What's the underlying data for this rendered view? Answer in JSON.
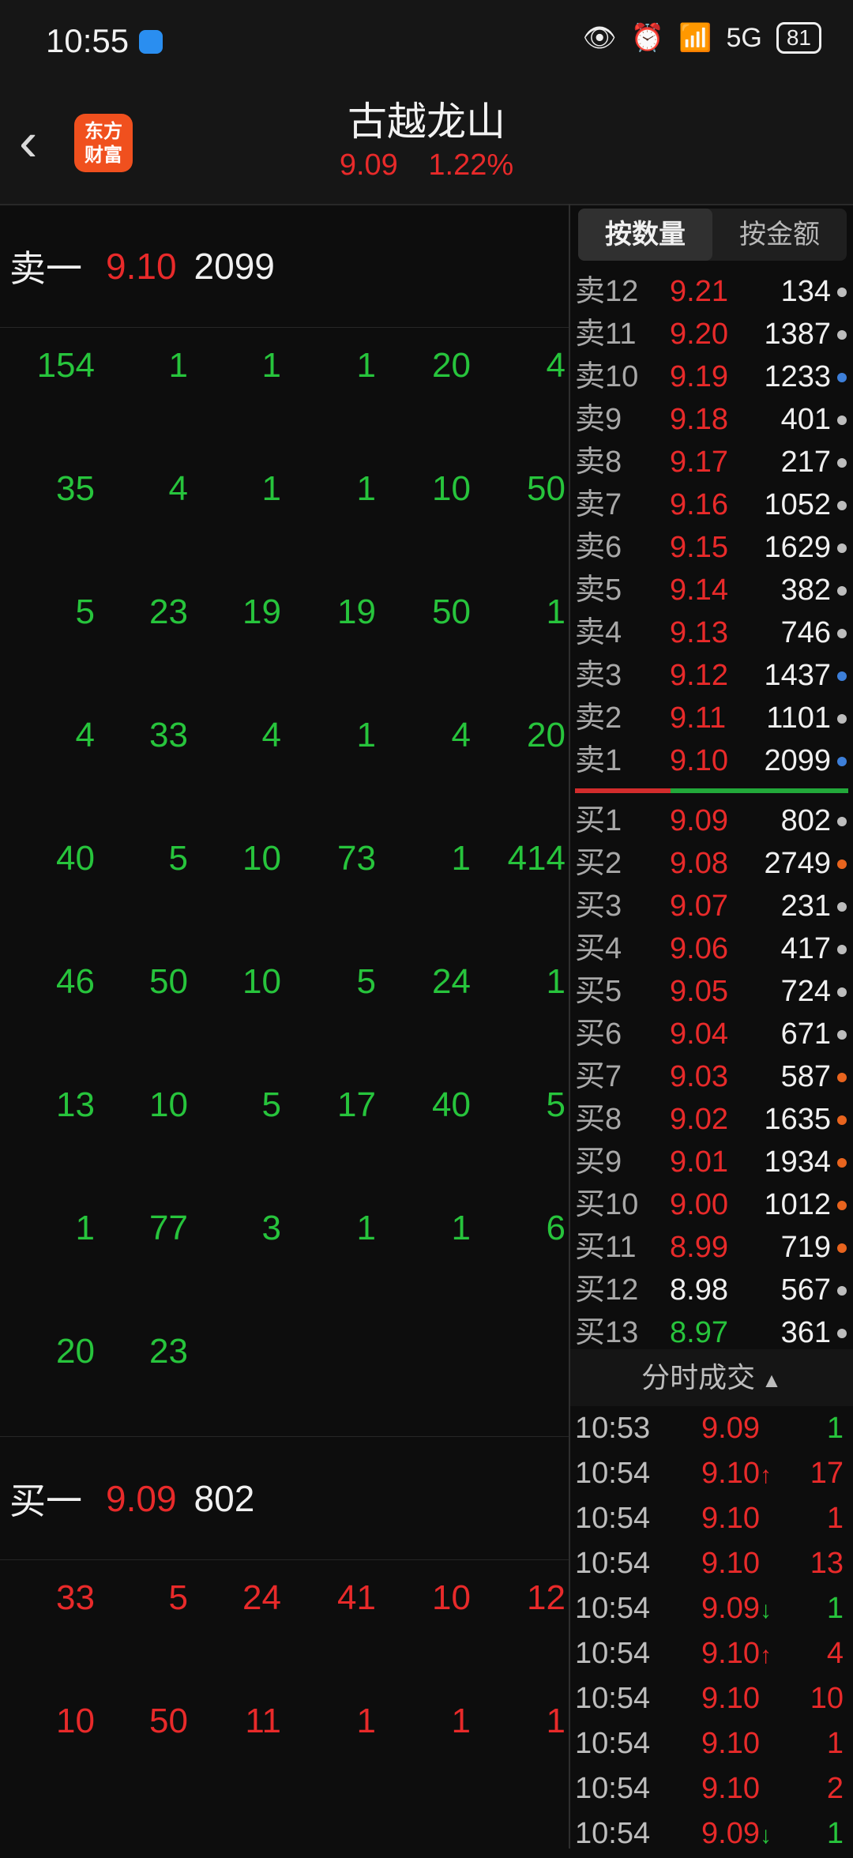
{
  "status_bar": {
    "time": "10:55",
    "icons": [
      "eye-icon",
      "alarm-icon",
      "wifi-icon",
      "signal-5g-icon"
    ],
    "network": "5G",
    "battery": "81"
  },
  "header": {
    "back_icon": "chevron-left-icon",
    "logo_line1": "东方",
    "logo_line2": "财富",
    "title": "古越龙山",
    "price": "9.09",
    "change_pct": "1.22%"
  },
  "left": {
    "sell1": {
      "label": "卖一",
      "price": "9.10",
      "volume": "2099"
    },
    "sell_queue": [
      [
        "154",
        "1",
        "1",
        "1",
        "20",
        "4"
      ],
      [
        "35",
        "4",
        "1",
        "1",
        "10",
        "50"
      ],
      [
        "5",
        "23",
        "19",
        "19",
        "50",
        "1"
      ],
      [
        "4",
        "33",
        "4",
        "1",
        "4",
        "20"
      ],
      [
        "40",
        "5",
        "10",
        "73",
        "1",
        "414"
      ],
      [
        "46",
        "50",
        "10",
        "5",
        "24",
        "1"
      ],
      [
        "13",
        "10",
        "5",
        "17",
        "40",
        "5"
      ],
      [
        "1",
        "77",
        "3",
        "1",
        "1",
        "6"
      ],
      [
        "20",
        "23",
        "",
        "",
        "",
        ""
      ]
    ],
    "buy1": {
      "label": "买一",
      "price": "9.09",
      "volume": "802"
    },
    "buy_queue": [
      [
        "33",
        "5",
        "24",
        "41",
        "10",
        "12"
      ],
      [
        "10",
        "50",
        "11",
        "1",
        "1",
        "1"
      ]
    ]
  },
  "right": {
    "tabs": [
      {
        "label": "按数量",
        "active": true
      },
      {
        "label": "按金额",
        "active": false
      }
    ],
    "asks": [
      {
        "level": "卖12",
        "price": "9.21",
        "volume": "134",
        "dot": "#bdbdbd"
      },
      {
        "level": "卖11",
        "price": "9.20",
        "volume": "1387",
        "dot": "#bdbdbd"
      },
      {
        "level": "卖10",
        "price": "9.19",
        "volume": "1233",
        "dot": "#3d7fd9"
      },
      {
        "level": "卖9",
        "price": "9.18",
        "volume": "401",
        "dot": "#bdbdbd"
      },
      {
        "level": "卖8",
        "price": "9.17",
        "volume": "217",
        "dot": "#bdbdbd"
      },
      {
        "level": "卖7",
        "price": "9.16",
        "volume": "1052",
        "dot": "#bdbdbd"
      },
      {
        "level": "卖6",
        "price": "9.15",
        "volume": "1629",
        "dot": "#bdbdbd"
      },
      {
        "level": "卖5",
        "price": "9.14",
        "volume": "382",
        "dot": "#bdbdbd"
      },
      {
        "level": "卖4",
        "price": "9.13",
        "volume": "746",
        "dot": "#bdbdbd"
      },
      {
        "level": "卖3",
        "price": "9.12",
        "volume": "1437",
        "dot": "#3d7fd9"
      },
      {
        "level": "卖2",
        "price": "9.11",
        "volume": "1101",
        "dot": "#bdbdbd"
      },
      {
        "level": "卖1",
        "price": "9.10",
        "volume": "2099",
        "dot": "#3d7fd9"
      }
    ],
    "bids": [
      {
        "level": "买1",
        "price": "9.09",
        "volume": "802",
        "dot": "#bdbdbd",
        "price_color": "red"
      },
      {
        "level": "买2",
        "price": "9.08",
        "volume": "2749",
        "dot": "#e8641e",
        "price_color": "red"
      },
      {
        "level": "买3",
        "price": "9.07",
        "volume": "231",
        "dot": "#bdbdbd",
        "price_color": "red"
      },
      {
        "level": "买4",
        "price": "9.06",
        "volume": "417",
        "dot": "#bdbdbd",
        "price_color": "red"
      },
      {
        "level": "买5",
        "price": "9.05",
        "volume": "724",
        "dot": "#bdbdbd",
        "price_color": "red"
      },
      {
        "level": "买6",
        "price": "9.04",
        "volume": "671",
        "dot": "#bdbdbd",
        "price_color": "red"
      },
      {
        "level": "买7",
        "price": "9.03",
        "volume": "587",
        "dot": "#e8641e",
        "price_color": "red"
      },
      {
        "level": "买8",
        "price": "9.02",
        "volume": "1635",
        "dot": "#e8641e",
        "price_color": "red"
      },
      {
        "level": "买9",
        "price": "9.01",
        "volume": "1934",
        "dot": "#e8641e",
        "price_color": "red"
      },
      {
        "level": "买10",
        "price": "9.00",
        "volume": "1012",
        "dot": "#e8641e",
        "price_color": "red"
      },
      {
        "level": "买11",
        "price": "8.99",
        "volume": "719",
        "dot": "#e8641e",
        "price_color": "red"
      },
      {
        "level": "买12",
        "price": "8.98",
        "volume": "567",
        "dot": "#bdbdbd",
        "price_color": "white"
      },
      {
        "level": "买13",
        "price": "8.97",
        "volume": "361",
        "dot": "#bdbdbd",
        "price_color": "green"
      }
    ],
    "trades_header": "分时成交",
    "trades": [
      {
        "time": "10:53",
        "price": "9.09",
        "arrow": "",
        "volume": "1",
        "vcolor": "green"
      },
      {
        "time": "10:54",
        "price": "9.10",
        "arrow": "↑",
        "volume": "17",
        "vcolor": "red"
      },
      {
        "time": "10:54",
        "price": "9.10",
        "arrow": "",
        "volume": "1",
        "vcolor": "red"
      },
      {
        "time": "10:54",
        "price": "9.10",
        "arrow": "",
        "volume": "13",
        "vcolor": "red"
      },
      {
        "time": "10:54",
        "price": "9.09",
        "arrow": "↓",
        "volume": "1",
        "vcolor": "green"
      },
      {
        "time": "10:54",
        "price": "9.10",
        "arrow": "↑",
        "volume": "4",
        "vcolor": "red"
      },
      {
        "time": "10:54",
        "price": "9.10",
        "arrow": "",
        "volume": "10",
        "vcolor": "red"
      },
      {
        "time": "10:54",
        "price": "9.10",
        "arrow": "",
        "volume": "1",
        "vcolor": "red"
      },
      {
        "time": "10:54",
        "price": "9.10",
        "arrow": "",
        "volume": "2",
        "vcolor": "red"
      },
      {
        "time": "10:54",
        "price": "9.09",
        "arrow": "↓",
        "volume": "1",
        "vcolor": "green"
      }
    ]
  }
}
